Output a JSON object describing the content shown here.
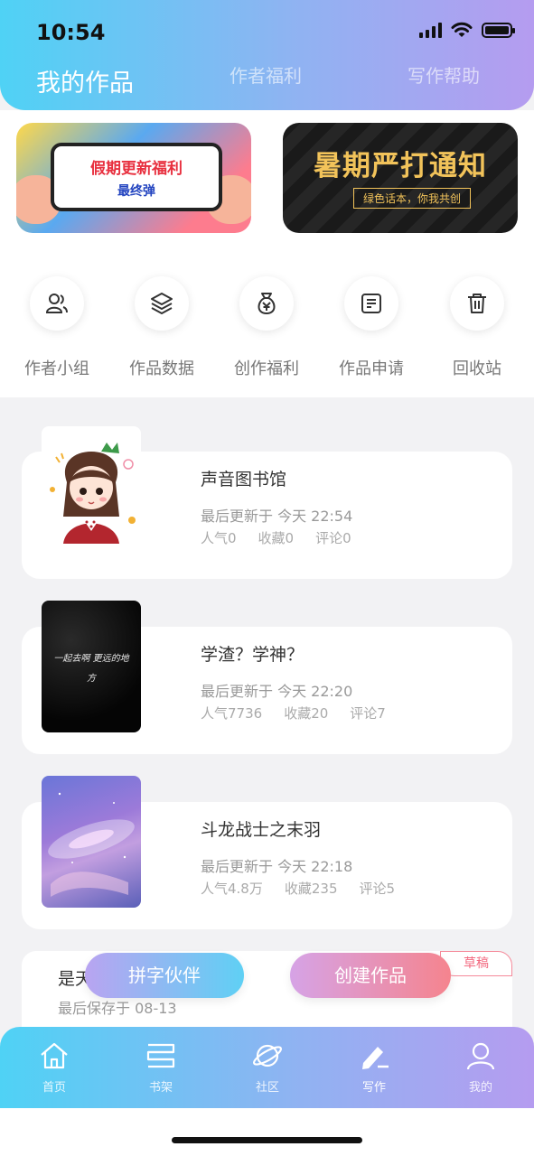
{
  "status_bar": {
    "time": "10:54"
  },
  "header": {
    "tabs": [
      {
        "label": "我的作品",
        "active": true
      },
      {
        "label": "作者福利",
        "active": false
      },
      {
        "label": "写作帮助",
        "active": false
      }
    ]
  },
  "banners": [
    {
      "line1": "假期更新福利",
      "line2": "最终弹"
    },
    {
      "line1": "暑期严打通知",
      "line2": "绿色话本，你我共创"
    }
  ],
  "shortcuts": [
    {
      "label": "作者小组",
      "icon": "people-icon"
    },
    {
      "label": "作品数据",
      "icon": "layers-icon"
    },
    {
      "label": "创作福利",
      "icon": "money-bag-icon"
    },
    {
      "label": "作品申请",
      "icon": "document-edit-icon"
    },
    {
      "label": "回收站",
      "icon": "trash-icon"
    }
  ],
  "works": [
    {
      "title": "声音图书馆",
      "updated": "最后更新于 今天 22:54",
      "popularity": "人气0",
      "favorites": "收藏0",
      "comments": "评论0"
    },
    {
      "title": "学渣？学神？",
      "updated": "最后更新于 今天 22:20",
      "popularity": "人气7736",
      "favorites": "收藏20",
      "comments": "评论7",
      "cover_text": "一起去啊 更远的地方"
    },
    {
      "title": "斗龙战士之末羽",
      "updated": "最后更新于 今天 22:18",
      "popularity": "人气4.8万",
      "favorites": "收藏235",
      "comments": "评论5"
    }
  ],
  "draft": {
    "title": "是天",
    "saved": "最后保存于 08-13",
    "badge": "草稿"
  },
  "floating_buttons": {
    "partner": "拼字伙伴",
    "create": "创建作品"
  },
  "tabbar": {
    "items": [
      {
        "label": "首页",
        "icon": "home-icon"
      },
      {
        "label": "书架",
        "icon": "bookshelf-icon"
      },
      {
        "label": "社区",
        "icon": "planet-icon"
      },
      {
        "label": "写作",
        "icon": "pen-icon",
        "active": true
      },
      {
        "label": "我的",
        "icon": "user-icon"
      }
    ]
  },
  "colors": {
    "gradient_start": "#4fd2f5",
    "gradient_end": "#b59cf0",
    "create_start": "#d6a3e6",
    "create_end": "#f5848e",
    "draft_badge": "#f26a80"
  }
}
